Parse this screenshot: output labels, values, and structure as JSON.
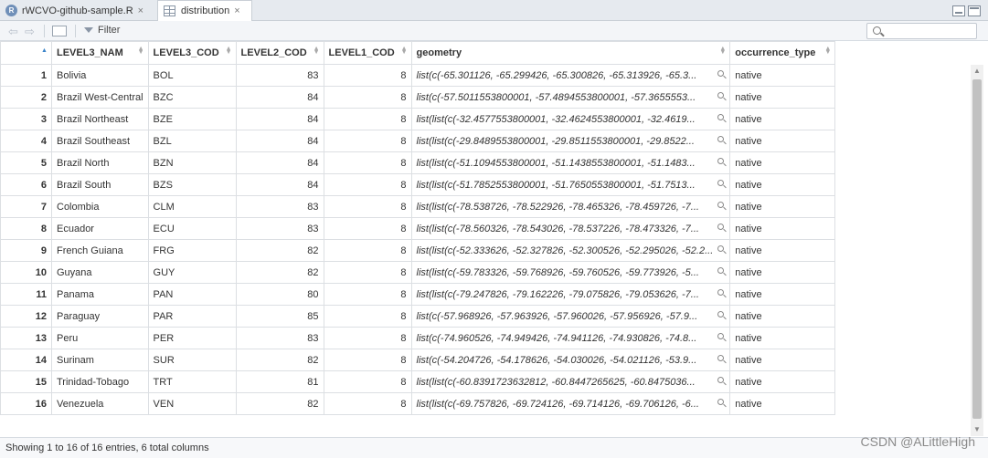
{
  "tabs": [
    {
      "label": "rWCVO-github-sample.R",
      "close": "×"
    },
    {
      "label": "distribution",
      "close": "×"
    }
  ],
  "toolbar": {
    "filter_label": "Filter",
    "search_placeholder": ""
  },
  "columns": [
    "LEVEL3_NAM",
    "LEVEL3_COD",
    "LEVEL2_COD",
    "LEVEL1_COD",
    "geometry",
    "occurrence_type"
  ],
  "rows": [
    {
      "idx": "1",
      "c": [
        "Bolivia",
        "BOL",
        "83",
        "8",
        "list(c(-65.301126, -65.299426, -65.300826, -65.313926, -65.3...",
        "native"
      ]
    },
    {
      "idx": "2",
      "c": [
        "Brazil West-Central",
        "BZC",
        "84",
        "8",
        "list(c(-57.5011553800001, -57.4894553800001, -57.3655553...",
        "native"
      ]
    },
    {
      "idx": "3",
      "c": [
        "Brazil Northeast",
        "BZE",
        "84",
        "8",
        "list(list(c(-32.4577553800001, -32.4624553800001, -32.4619...",
        "native"
      ]
    },
    {
      "idx": "4",
      "c": [
        "Brazil Southeast",
        "BZL",
        "84",
        "8",
        "list(list(c(-29.8489553800001, -29.8511553800001, -29.8522...",
        "native"
      ]
    },
    {
      "idx": "5",
      "c": [
        "Brazil North",
        "BZN",
        "84",
        "8",
        "list(list(c(-51.1094553800001, -51.1438553800001, -51.1483...",
        "native"
      ]
    },
    {
      "idx": "6",
      "c": [
        "Brazil South",
        "BZS",
        "84",
        "8",
        "list(list(c(-51.7852553800001, -51.7650553800001, -51.7513...",
        "native"
      ]
    },
    {
      "idx": "7",
      "c": [
        "Colombia",
        "CLM",
        "83",
        "8",
        "list(list(c(-78.538726, -78.522926, -78.465326, -78.459726, -7...",
        "native"
      ]
    },
    {
      "idx": "8",
      "c": [
        "Ecuador",
        "ECU",
        "83",
        "8",
        "list(list(c(-78.560326, -78.543026, -78.537226, -78.473326, -7...",
        "native"
      ]
    },
    {
      "idx": "9",
      "c": [
        "French Guiana",
        "FRG",
        "82",
        "8",
        "list(list(c(-52.333626, -52.327826, -52.300526, -52.295026, -52.2...",
        "native"
      ]
    },
    {
      "idx": "10",
      "c": [
        "Guyana",
        "GUY",
        "82",
        "8",
        "list(list(c(-59.783326, -59.768926, -59.760526, -59.773926, -5...",
        "native"
      ]
    },
    {
      "idx": "11",
      "c": [
        "Panama",
        "PAN",
        "80",
        "8",
        "list(list(c(-79.247826, -79.162226, -79.075826, -79.053626, -7...",
        "native"
      ]
    },
    {
      "idx": "12",
      "c": [
        "Paraguay",
        "PAR",
        "85",
        "8",
        "list(c(-57.968926, -57.963926, -57.960026, -57.956926, -57.9...",
        "native"
      ]
    },
    {
      "idx": "13",
      "c": [
        "Peru",
        "PER",
        "83",
        "8",
        "list(c(-74.960526, -74.949426, -74.941126, -74.930826, -74.8...",
        "native"
      ]
    },
    {
      "idx": "14",
      "c": [
        "Surinam",
        "SUR",
        "82",
        "8",
        "list(c(-54.204726, -54.178626, -54.030026, -54.021126, -53.9...",
        "native"
      ]
    },
    {
      "idx": "15",
      "c": [
        "Trinidad-Tobago",
        "TRT",
        "81",
        "8",
        "list(list(c(-60.8391723632812, -60.8447265625, -60.8475036...",
        "native"
      ]
    },
    {
      "idx": "16",
      "c": [
        "Venezuela",
        "VEN",
        "82",
        "8",
        "list(list(c(-69.757826, -69.724126, -69.714126, -69.706126, -6...",
        "native"
      ]
    }
  ],
  "status": "Showing 1 to 16 of 16 entries, 6 total columns",
  "watermark": "CSDN @ALittleHigh"
}
